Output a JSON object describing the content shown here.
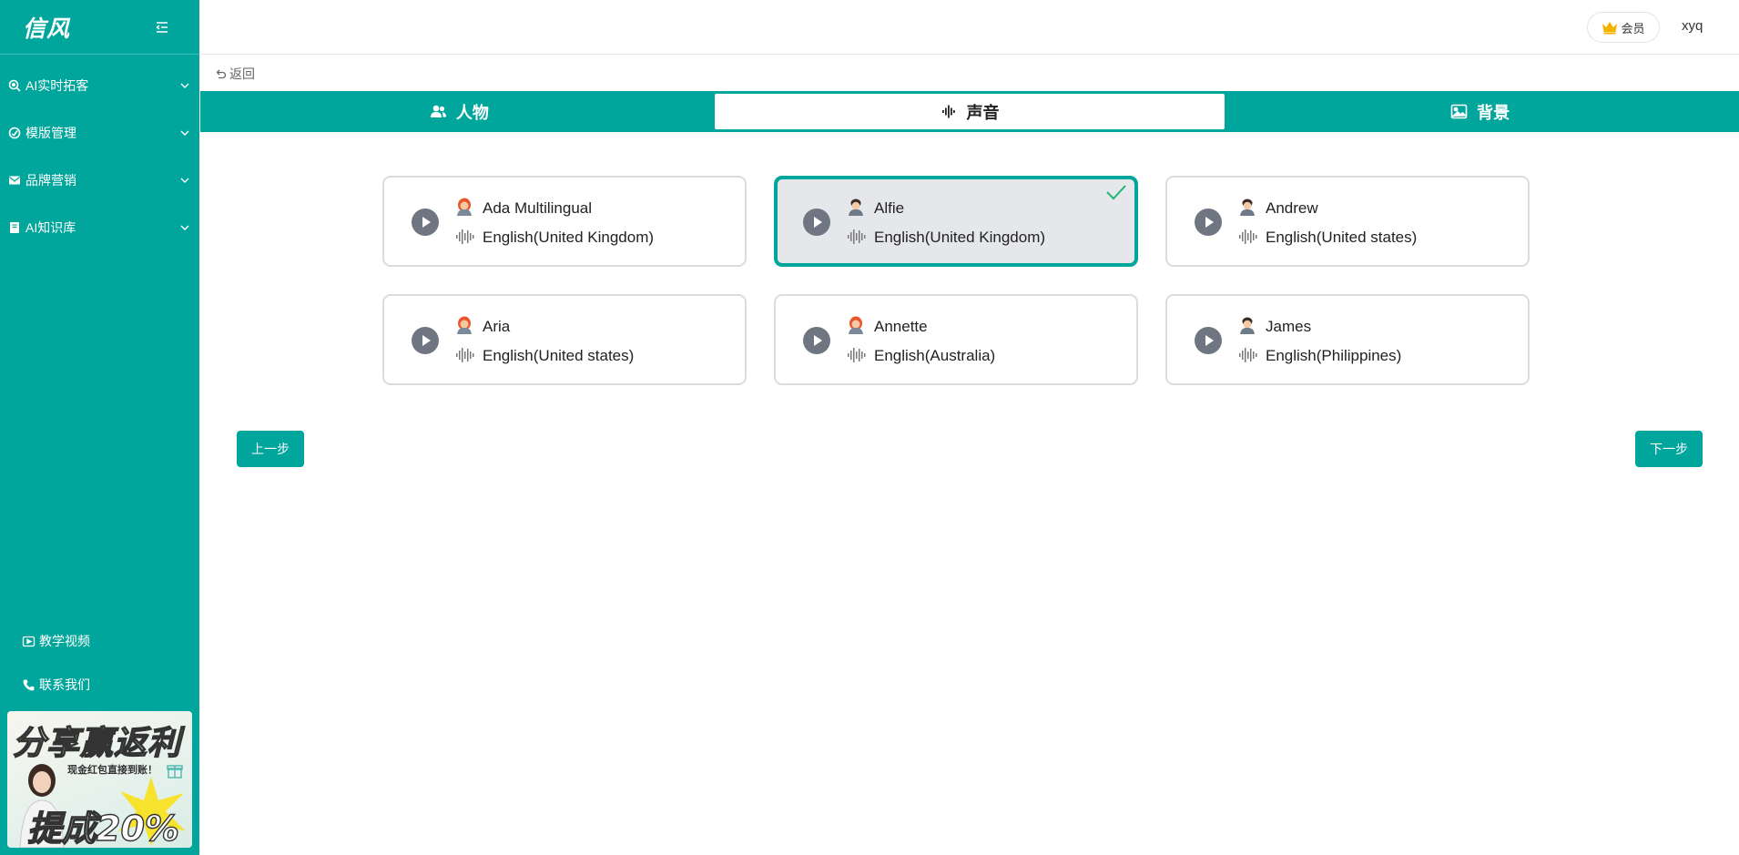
{
  "sidebar": {
    "logo": "信风",
    "menu": [
      {
        "label": "AI实时拓客",
        "icon": "search-target-icon"
      },
      {
        "label": "模版管理",
        "icon": "gauge-icon"
      },
      {
        "label": "品牌营销",
        "icon": "mail-icon"
      },
      {
        "label": "AI知识库",
        "icon": "book-icon"
      }
    ],
    "links": [
      {
        "label": "教学视频",
        "icon": "video-icon"
      },
      {
        "label": "联系我们",
        "icon": "phone-icon"
      }
    ],
    "promo": {
      "title": "分享赢返利",
      "subtitle": "现金红包直接到账！",
      "rate": "提成20%"
    }
  },
  "header": {
    "vip_label": "会员",
    "username": "xyq"
  },
  "back_label": "返回",
  "tabs": [
    {
      "label": "人物",
      "icon": "users-icon",
      "active": false
    },
    {
      "label": "声音",
      "icon": "waveform-icon",
      "active": true
    },
    {
      "label": "背景",
      "icon": "image-icon",
      "active": false
    }
  ],
  "voices": [
    {
      "name": "Ada Multilingual",
      "language": "English(United Kingdom)",
      "gender": "female",
      "selected": false
    },
    {
      "name": "Alfie",
      "language": "English(United Kingdom)",
      "gender": "male",
      "selected": true
    },
    {
      "name": "Andrew",
      "language": "English(United states)",
      "gender": "male",
      "selected": false
    },
    {
      "name": "Aria",
      "language": "English(United states)",
      "gender": "female",
      "selected": false
    },
    {
      "name": "Annette",
      "language": "English(Australia)",
      "gender": "female",
      "selected": false
    },
    {
      "name": "James",
      "language": "English(Philippines)",
      "gender": "male",
      "selected": false
    }
  ],
  "buttons": {
    "prev": "上一步",
    "next": "下一步"
  },
  "colors": {
    "accent": "#00a69c",
    "selected_bg": "#e5e7ea",
    "check": "#22b573"
  }
}
